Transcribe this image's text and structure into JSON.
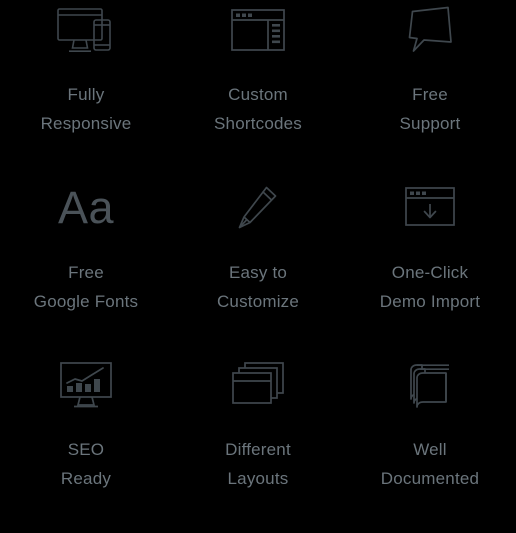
{
  "theme": {
    "background": "#000000",
    "icon_stroke": "#3f474d",
    "label_color": "#6b757c"
  },
  "grid": {
    "columns": 3,
    "rows": 3
  },
  "features": [
    {
      "icon": "responsive-devices-icon",
      "line1": "Fully",
      "line2": "Responsive"
    },
    {
      "icon": "browser-sidebar-icon",
      "line1": "Custom",
      "line2": "Shortcodes"
    },
    {
      "icon": "speech-bubble-icon",
      "line1": "Free",
      "line2": "Support"
    },
    {
      "icon": "typography-aa-icon",
      "glyph": "Aa",
      "line1": "Free",
      "line2": "Google Fonts"
    },
    {
      "icon": "pencil-icon",
      "line1": "Easy to",
      "line2": "Customize"
    },
    {
      "icon": "browser-download-icon",
      "line1": "One-Click",
      "line2": "Demo Import"
    },
    {
      "icon": "monitor-chart-icon",
      "line1": "SEO",
      "line2": "Ready"
    },
    {
      "icon": "stacked-windows-icon",
      "line1": "Different",
      "line2": "Layouts"
    },
    {
      "icon": "book-icon",
      "line1": "Well",
      "line2": "Documented"
    }
  ]
}
